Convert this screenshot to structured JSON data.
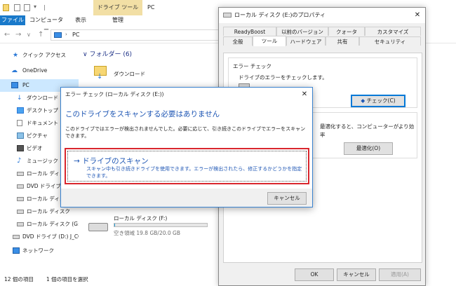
{
  "explorer": {
    "title": "PC",
    "context_tab": "ドライブ ツール",
    "ribbon_tabs": [
      "ファイル",
      "コンピューター",
      "表示",
      "管理"
    ],
    "address": "PC",
    "folders_header": "フォルダー (6)",
    "downloads_folder": "ダウンロード",
    "drive_f": {
      "name": "ローカル ディスク (F:)",
      "space": "空き領域 19.8 GB/20.0 GB",
      "used_fraction": 0.01
    },
    "sidebar": [
      "クイック アクセス",
      "OneDrive",
      "PC",
      "ダウンロード",
      "デスクトップ",
      "ドキュメント",
      "ピクチャ",
      "ビデオ",
      "ミュージック",
      "ローカル ディスク",
      "DVD ドライブ (",
      "ローカル ディスク",
      "ローカル ディスク",
      "ローカル ディスク (G:)",
      "DVD ドライブ (D:) J_CCS",
      "ネットワーク"
    ],
    "status_items": "12 個の項目",
    "status_selected": "1 個の項目を選択"
  },
  "props": {
    "title": "ローカル ディスク (E:)のプロパティ",
    "tabs_row1": [
      "ReadyBoost",
      "以前のバージョン",
      "クォータ",
      "カスタマイズ"
    ],
    "tabs_row2": [
      "全般",
      "ツール",
      "ハードウェア",
      "共有",
      "セキュリティ"
    ],
    "error_group": "エラー チェック",
    "error_text": "ドライブのエラーをチェックします。",
    "check_button": "チェック(C)",
    "optimize_text": "最適化すると、コンピューターがより効",
    "optimize_text2": "率",
    "optimize_button": "最適化(O)",
    "ok": "OK",
    "cancel": "キャンセル",
    "apply": "適用(A)"
  },
  "errdlg": {
    "title": "エラー チェック (ローカル ディスク (E:))",
    "heading": "このドライブをスキャンする必要はありません",
    "message": "このドライブではエラーが検出されませんでした。必要に応じて、引き続きこのドライブでエラーをスキャンできます。",
    "scan_title": "→ ドライブのスキャン",
    "scan_desc": "スキャン中も引き続きドライブを使用できます。エラーが検出されたら、修正するかどうかを指定できます。",
    "cancel": "キャンセル"
  },
  "colors": {
    "accent": "#1e56b4",
    "highlight_red": "#d9262d",
    "ribbon_blue": "#1979ca"
  }
}
